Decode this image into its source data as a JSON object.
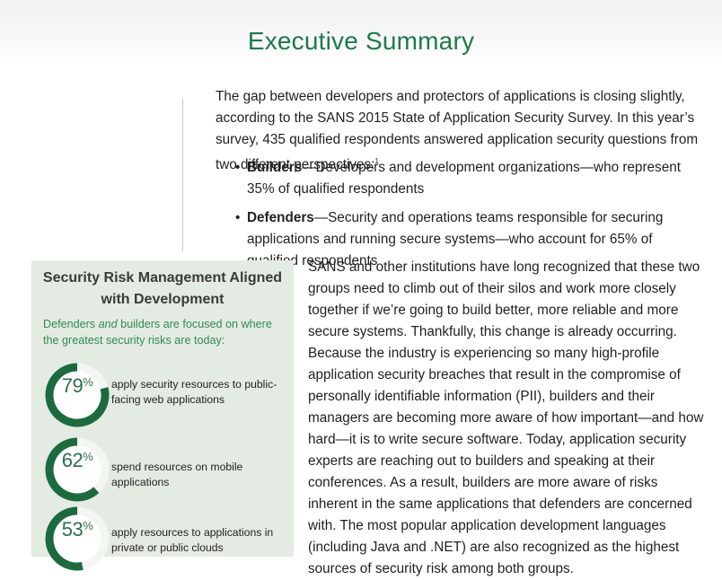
{
  "header": {
    "title": "Executive Summary"
  },
  "intro": {
    "text": "The gap between developers and protectors of applications is closing slightly, according to the SANS 2015 State of Application Security Survey. In this year’s survey, 435 qualified respondents answered application security questions from two different perspectives:",
    "footnote": "1"
  },
  "bullets": [
    {
      "term": "Builders",
      "text": "—Developers and development organizations—who represent 35% of qualified respondents"
    },
    {
      "term": "Defenders",
      "text": "—Security and operations teams responsible for securing applications and running secure systems—who account for 65% of qualified respondents"
    }
  ],
  "body": {
    "p2": "SANS and other institutions have long recognized that these two groups need to climb out of their silos and work more closely together if we’re going to build better, more reliable and more secure systems. Thankfully, this change is already occurring.",
    "p3": "Because the industry is experiencing so many high-profile application security breaches that result in the compromise of personally identifiable information (PII), builders and their managers are becoming more aware of how important—and how hard—it is to write secure software. Today, application security experts are reaching out to builders and speaking at their conferences. As a result, builders are more aware of risks inherent in the same applications that defenders are concerned with. The most popular application development languages (including Java and .NET) are also recognized as the highest sources of security risk among both groups."
  },
  "sidebar": {
    "title_line1": "Security Risk Management Aligned",
    "title_line2": "with Development",
    "sub_a": "Defenders ",
    "sub_em": "and",
    "sub_b": " builders are focused on where the greatest security risks are today:",
    "stats": [
      {
        "value": 79,
        "pct": "79",
        "label": "apply security resources to public-facing web applications"
      },
      {
        "value": 62,
        "pct": "62",
        "label": "spend resources on mobile applications"
      },
      {
        "value": 53,
        "pct": "53",
        "label": "apply resources to applications in private or public clouds"
      }
    ],
    "percent_sign": "%"
  },
  "colors": {
    "accent_green": "#1e7a4c",
    "ring_fill": "#1b6b3f",
    "ring_track": "#f4f6f3",
    "sidebar_bg": "#e4ebe2"
  }
}
